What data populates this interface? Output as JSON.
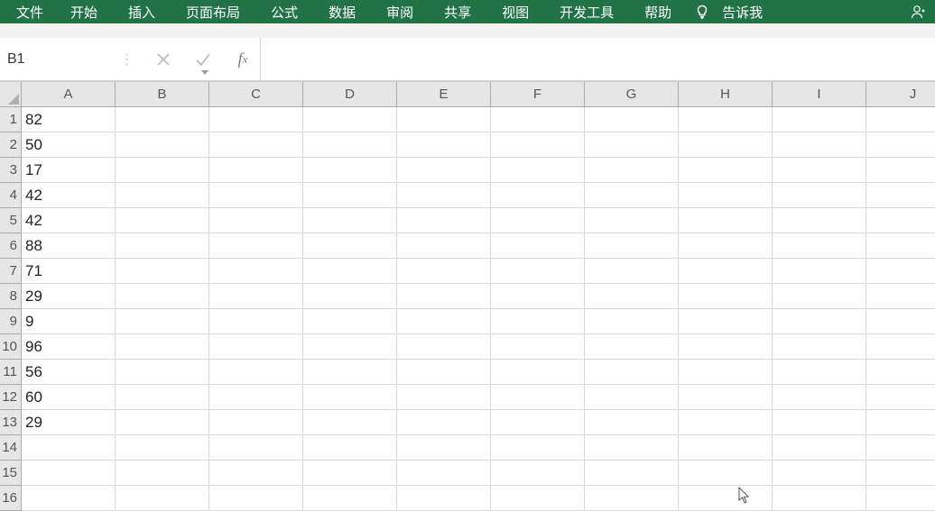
{
  "ribbon": {
    "tabs": {
      "file": "文件",
      "home": "开始",
      "insert": "插入",
      "layout": "页面布局",
      "formulas": "公式",
      "data": "数据",
      "review": "审阅",
      "share": "共享",
      "view": "视图",
      "dev": "开发工具",
      "help": "帮助",
      "tellme": "告诉我"
    }
  },
  "formula": {
    "namebox": "B1",
    "input": ""
  },
  "columns": [
    "A",
    "B",
    "C",
    "D",
    "E",
    "F",
    "G",
    "H",
    "I",
    "J"
  ],
  "rows": [
    1,
    2,
    3,
    4,
    5,
    6,
    7,
    8,
    9,
    10,
    11,
    12,
    13,
    14,
    15,
    16
  ],
  "data": {
    "A": [
      "82",
      "50",
      "17",
      "42",
      "42",
      "88",
      "71",
      "29",
      "9",
      "96",
      "56",
      "60",
      "29",
      "",
      "",
      ""
    ]
  }
}
